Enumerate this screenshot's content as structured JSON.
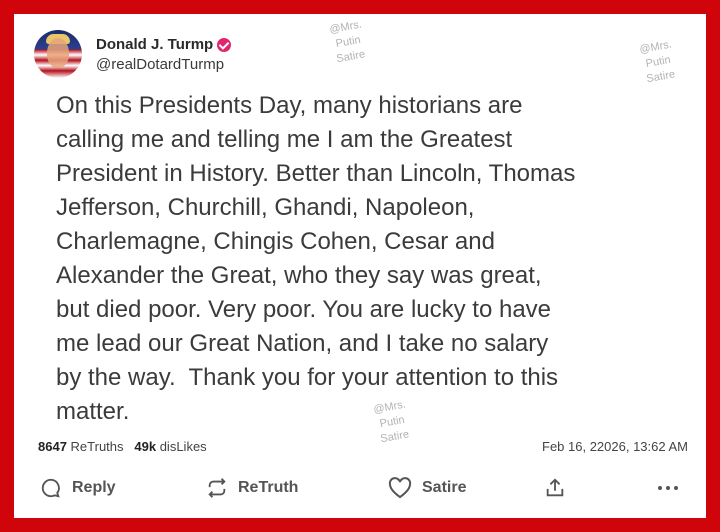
{
  "post": {
    "display_name": "Donald J. Turmp",
    "handle": "@realDotardTurmp",
    "text": "On this Presidents Day, many historians are\ncalling me and telling me I am the Greatest\nPresident in History. Better than Lincoln, Thomas\nJefferson, Churchill, Ghandi, Napoleon,\nCharlemagne, Chingis Cohen, Cesar and\nAlexander the Great, who they say was great,\nbut died poor. Very poor. You are lucky to have\nme lead our Great Nation, and I take no salary\nby the way.  Thank you for your attention to this\nmatter.",
    "retruths_count": "8647",
    "retruths_label": "ReTruths",
    "dislikes_count": "49k",
    "dislikes_label": "disLikes",
    "timestamp": "Feb 16, 22026, 13:62 AM"
  },
  "watermark": {
    "line1": "@Mrs.",
    "line2": "Putin",
    "line3": "Satire"
  },
  "actions": {
    "reply": "Reply",
    "retruth": "ReTruth",
    "satire": "Satire"
  },
  "colors": {
    "border": "#d0050c",
    "verified": "#e2256e"
  },
  "icons": [
    "reply-icon",
    "retruth-icon",
    "heart-icon",
    "share-icon",
    "more-icon",
    "verified-icon"
  ]
}
